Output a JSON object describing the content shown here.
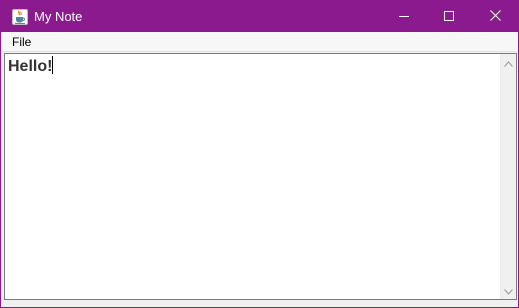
{
  "window": {
    "title": "My Note",
    "title_bar_color": "#8b1a8e",
    "app_icon": "java-cup-icon",
    "controls": {
      "minimize": "minimize-icon",
      "maximize": "maximize-icon",
      "close": "close-icon"
    }
  },
  "menubar": {
    "items": [
      {
        "label": "File"
      }
    ]
  },
  "editor": {
    "text": "Hello!",
    "text_color": "#333333"
  }
}
